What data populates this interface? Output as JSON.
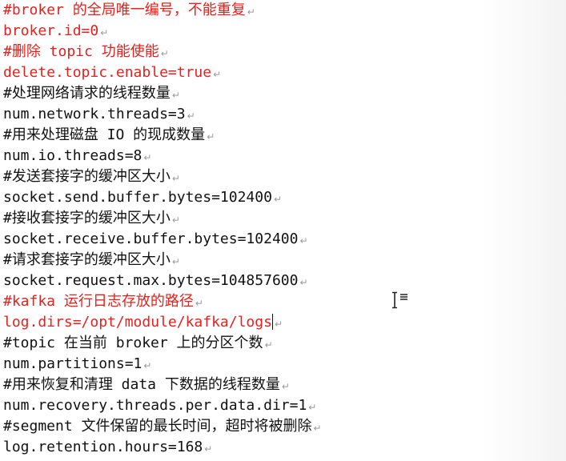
{
  "editor": {
    "paragraph_mark": "↵",
    "lines": [
      {
        "text": "#broker 的全局唯一编号，不能重复",
        "color": "red"
      },
      {
        "text": "broker.id=0",
        "color": "red"
      },
      {
        "text": "#删除 topic 功能使能",
        "color": "red"
      },
      {
        "text": "delete.topic.enable=true",
        "color": "red"
      },
      {
        "text": "#处理网络请求的线程数量",
        "color": "black"
      },
      {
        "text": "num.network.threads=3",
        "color": "black"
      },
      {
        "text": "#用来处理磁盘 IO 的现成数量",
        "color": "black"
      },
      {
        "text": "num.io.threads=8",
        "color": "black"
      },
      {
        "text": "#发送套接字的缓冲区大小",
        "color": "black"
      },
      {
        "text": "socket.send.buffer.bytes=102400",
        "color": "black"
      },
      {
        "text": "#接收套接字的缓冲区大小",
        "color": "black"
      },
      {
        "text": "socket.receive.buffer.bytes=102400",
        "color": "black"
      },
      {
        "text": "#请求套接字的缓冲区大小",
        "color": "black"
      },
      {
        "text": "socket.request.max.bytes=104857600",
        "color": "black"
      },
      {
        "text": "#kafka 运行日志存放的路径",
        "color": "red"
      },
      {
        "text": "log.dirs=/opt/module/kafka/logs",
        "color": "red"
      },
      {
        "text": "#topic 在当前 broker 上的分区个数",
        "color": "black"
      },
      {
        "text": "num.partitions=1",
        "color": "black"
      },
      {
        "text": "#用来恢复和清理 data 下数据的线程数量",
        "color": "black"
      },
      {
        "text": "num.recovery.threads.per.data.dir=1",
        "color": "black"
      },
      {
        "text": "#segment 文件保留的最长时间，超时将被删除",
        "color": "black"
      },
      {
        "text": "log.retention.hours=168",
        "color": "black"
      }
    ]
  },
  "colors": {
    "red": "#e8201d",
    "black": "#111111",
    "paragraph_mark": "#9a9a9a"
  },
  "cursor_icon": "i-beam-text-cursor-icon"
}
